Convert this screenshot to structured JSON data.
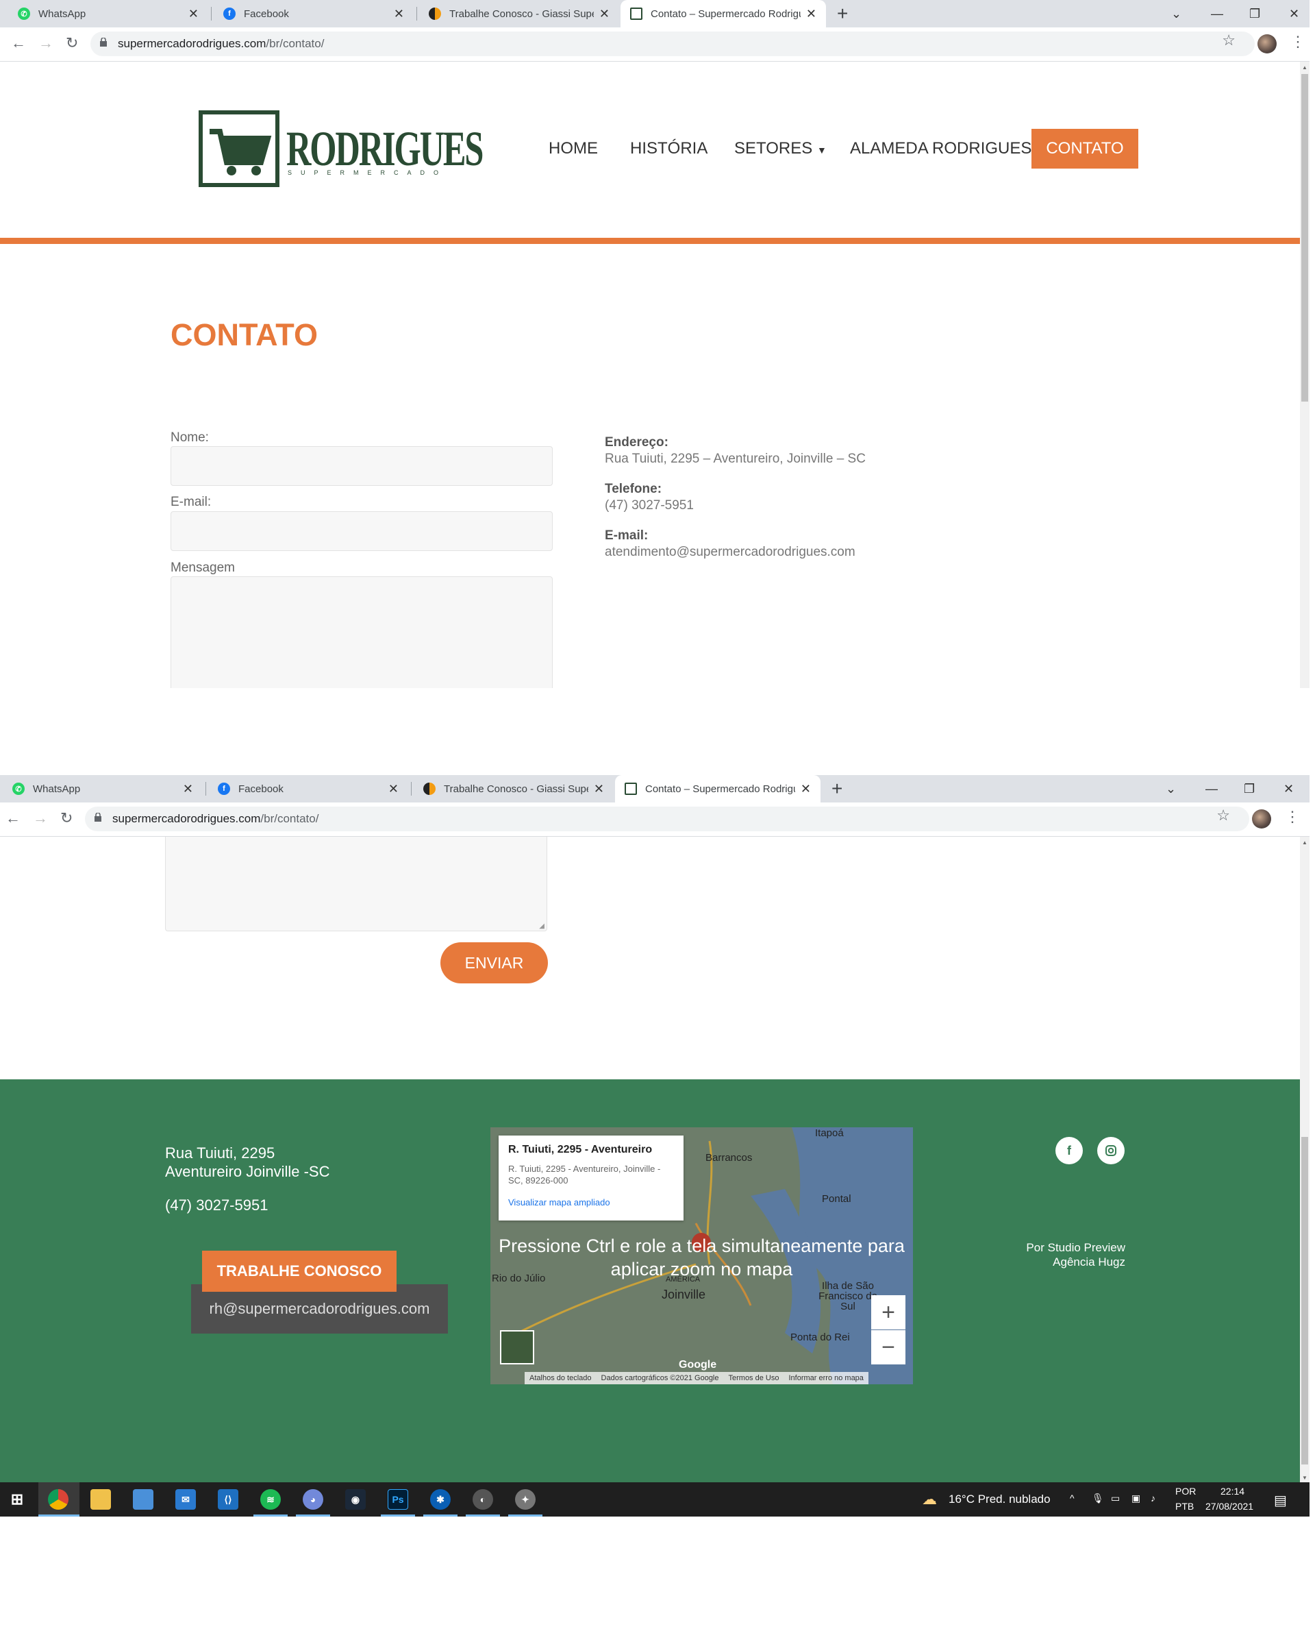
{
  "browser": {
    "tabs": [
      {
        "title": "WhatsApp",
        "icon": "whatsapp-icon",
        "color": "#25d366"
      },
      {
        "title": "Facebook",
        "icon": "facebook-icon",
        "color": "#1877f2"
      },
      {
        "title": "Trabalhe Conosco - Giassi Supermercados",
        "icon": "giassi-icon",
        "color": "#d9541e"
      },
      {
        "title": "Contato – Supermercado Rodrigues",
        "icon": "page-icon",
        "color": "#2a4b33"
      }
    ],
    "url_host": "supermercadorodrigues.com",
    "url_path": "/br/contato/"
  },
  "site": {
    "logo_word": "RODRIGUES",
    "logo_sub": "SUPERMERCADO",
    "menu": [
      "HOME",
      "HISTÓRIA",
      "SETORES",
      "ALAMEDA RODRIGUES"
    ],
    "menu_active": "CONTATO",
    "accent_color": "#e7793b",
    "brand_green": "#2a4b33"
  },
  "contact": {
    "title": "CONTATO",
    "fields": {
      "name_label": "Nome:",
      "email_label": "E-mail:",
      "message_label": "Mensagem"
    },
    "submit": "ENVIAR",
    "address_label": "Endereço:",
    "address": "Rua Tuiuti, 2295 – Aventureiro, Joinville – SC",
    "phone_label": "Telefone:",
    "phone": "(47) 3027-5951",
    "email_label": "E-mail:",
    "email": "atendimento@supermercadorodrigues.com"
  },
  "footer": {
    "address_line1": "Rua Tuiuti, 2295",
    "address_line2": "Aventureiro Joinville  -SC",
    "phone": "(47) 3027-5951",
    "work_button": "TRABALHE CONOSCO",
    "work_email": "rh@supermercadorodrigues.com",
    "credit_line1": "Por Studio Preview",
    "credit_line2": "Agência Hugz",
    "footer_color": "#397e56"
  },
  "map": {
    "place_title": "R. Tuiuti, 2295 - Aventureiro",
    "place_address": "R. Tuiuti, 2295 - Aventureiro, Joinville - SC, 89226-000",
    "view_larger": "Visualizar mapa ampliado",
    "overlay": "Pressione Ctrl e role a tela simultaneamente para aplicar zoom no mapa",
    "labels": [
      "Itapoá",
      "Barrancos",
      "Pontal",
      "Rio do Júlio",
      "Joinville",
      "Ilha de São Francisco do Sul",
      "Ponta do Rei",
      "AMÉRICA"
    ],
    "attribution": [
      "Atalhos do teclado",
      "Dados cartográficos ©2021 Google",
      "Termos de Uso",
      "Informar erro no mapa"
    ],
    "zoom_in": "+",
    "zoom_out": "−"
  },
  "taskbar": {
    "weather": "16°C  Pred. nublado",
    "lang1": "POR",
    "lang2": "PTB",
    "time": "22:14",
    "date": "27/08/2021"
  }
}
